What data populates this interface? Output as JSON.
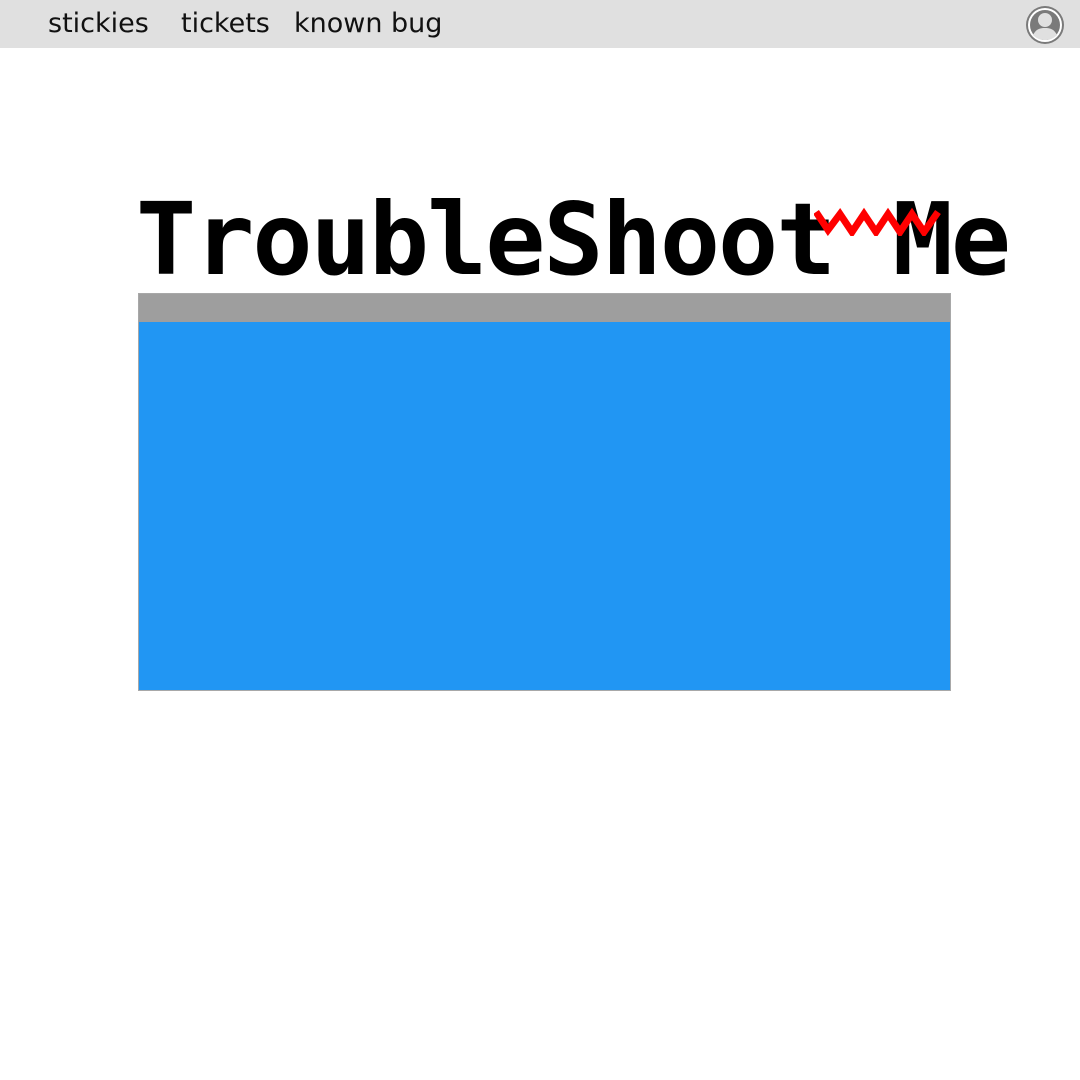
{
  "nav": {
    "items": [
      {
        "label": "stickies"
      },
      {
        "label": "tickets"
      },
      {
        "label": "known bug"
      }
    ]
  },
  "user": {
    "icon": "user-avatar-icon"
  },
  "page": {
    "title": "TroubleShoot Me",
    "spellcheck_marked_word": "Me"
  },
  "colors": {
    "topbar_background": "#e0e0e0",
    "panel_header": "#9e9e9e",
    "panel_body": "#2196f3",
    "spellcheck_underline": "#ff0000"
  }
}
